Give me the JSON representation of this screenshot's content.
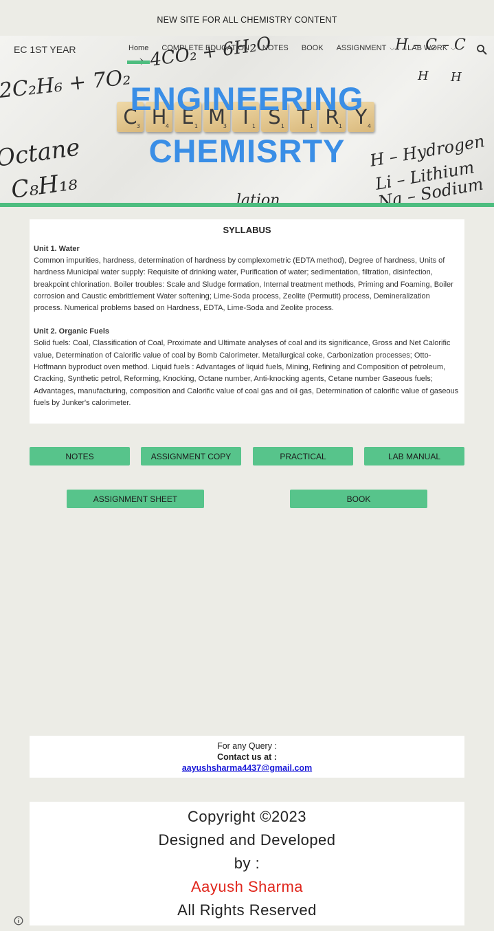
{
  "announcement": "NEW SITE FOR ALL CHEMISTRY CONTENT",
  "header": {
    "site_title": "EC 1ST YEAR",
    "nav": [
      {
        "label": "Home",
        "active": true
      },
      {
        "label": "COMPLETE EDUCATION"
      },
      {
        "label": "NOTES"
      },
      {
        "label": "BOOK"
      },
      {
        "label": "ASSIGNMENT",
        "dropdown": true
      },
      {
        "label": "LAB WORK",
        "dropdown": true
      }
    ],
    "search_icon": "search-icon"
  },
  "hero": {
    "title_line1": "ENGINEERING",
    "title_line2": "CHEMISRTY",
    "tiles": [
      {
        "letter": "C",
        "score": "3"
      },
      {
        "letter": "H",
        "score": "4"
      },
      {
        "letter": "E",
        "score": "1"
      },
      {
        "letter": "M",
        "score": "3"
      },
      {
        "letter": "I",
        "score": "1"
      },
      {
        "letter": "S",
        "score": "1"
      },
      {
        "letter": "T",
        "score": "1"
      },
      {
        "letter": "R",
        "score": "1"
      },
      {
        "letter": "Y",
        "score": "4"
      }
    ],
    "background_scribbles": [
      "2C₂H₆ + 7O₂",
      "→ 4CO₂ + 6H₂O",
      "Octane",
      "C₈H₁₈",
      "H – Hydrogen",
      "Li – Lithium",
      "Na – Sodium",
      "H–C–C",
      "H   H",
      "H",
      "lation"
    ]
  },
  "colors": {
    "accent": "#4dbd7f",
    "button": "#57c48b",
    "hero_title": "#3a8ee6",
    "author": "#e0261c",
    "link": "#1a1ad8"
  },
  "syllabus": {
    "title": "SYLLABUS",
    "units": [
      {
        "title": "Unit 1. Water",
        "text": "Common impurities, hardness, determination of hardness by complexometric (EDTA method), Degree of hardness, Units of hardness Municipal water supply: Requisite of drinking water, Purification of water; sedimentation, filtration, disinfection, breakpoint chlorination. Boiler troubles: Scale and Sludge formation, Internal treatment methods, Priming and Foaming, Boiler corrosion and Caustic embrittlement Water softening; Lime-Soda process, Zeolite (Permutit) process, Demineralization process. Numerical problems based on Hardness, EDTA, Lime-Soda and Zeolite process."
      },
      {
        "title": "Unit 2. Organic Fuels",
        "text": "Solid fuels: Coal, Classification of Coal, Proximate and Ultimate analyses of coal and its significance, Gross and Net Calorific value, Determination of Calorific value of coal by Bomb Calorimeter. Metallurgical coke, Carbonization processes; Otto-Hoffmann byproduct oven method. Liquid fuels : Advantages of liquid fuels, Mining, Refining and Composition of petroleum, Cracking, Synthetic petrol, Reforming, Knocking, Octane number, Anti-knocking agents, Cetane number Gaseous fuels; Advantages, manufacturing, composition and Calorific value of coal gas and oil gas, Determination of calorific value of gaseous fuels by Junker's calorimeter."
      }
    ]
  },
  "buttons": {
    "notes": "NOTES",
    "assignment_copy": "ASSIGNMENT COPY",
    "practical": "PRACTICAL",
    "lab_manual": "LAB MANUAL",
    "assignment_sheet": "ASSIGNMENT SHEET",
    "book": "BOOK"
  },
  "query": {
    "line1": "For any Query :",
    "line2": "Contact us at :",
    "email": "aayushsharma4437@gmail.com"
  },
  "footer": {
    "line1": "Copyright  ©2023",
    "line2": "Designed and Developed",
    "line3": "by :",
    "author": "Aayush Sharma",
    "line5": "All Rights Reserved"
  }
}
